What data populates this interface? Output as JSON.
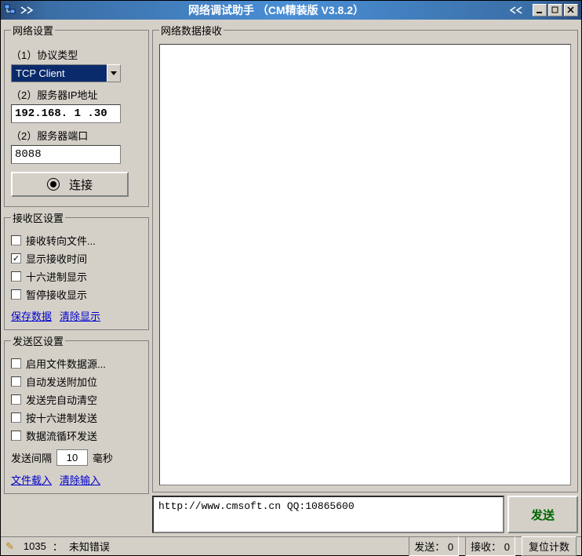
{
  "title": "网络调试助手 （CM精装版 V3.8.2）",
  "groups": {
    "network": {
      "legend": "网络设置",
      "protocol_label": "（1）协议类型",
      "protocol_value": "TCP Client",
      "ip_label": "（2）服务器IP地址",
      "ip_value": "192.168. 1 .30",
      "port_label": "（2）服务器端口",
      "port_value": "8088",
      "connect_btn": "连接"
    },
    "recv": {
      "legend": "接收区设置",
      "opts": [
        {
          "label": "接收转向文件...",
          "checked": false
        },
        {
          "label": "显示接收时间",
          "checked": true
        },
        {
          "label": "十六进制显示",
          "checked": false
        },
        {
          "label": "暂停接收显示",
          "checked": false
        }
      ],
      "link_save": "保存数据",
      "link_clear": "清除显示"
    },
    "send": {
      "legend": "发送区设置",
      "opts": [
        {
          "label": "启用文件数据源...",
          "checked": false
        },
        {
          "label": "自动发送附加位",
          "checked": false
        },
        {
          "label": "发送完自动清空",
          "checked": false
        },
        {
          "label": "按十六进制发送",
          "checked": false
        },
        {
          "label": "数据流循环发送",
          "checked": false
        }
      ],
      "interval_label": "发送间隔",
      "interval_value": "10",
      "interval_unit": "毫秒",
      "link_file": "文件载入",
      "link_clear": "清除输入"
    }
  },
  "right": {
    "recv_legend": "网络数据接收",
    "send_text": "http://www.cmsoft.cn QQ:10865600",
    "send_btn": "发送"
  },
  "status": {
    "code": "1035",
    "msg": "未知错误",
    "sent_label": "发送：",
    "sent_value": "0",
    "recv_label": "接收：",
    "recv_value": "0",
    "reset_btn": "复位计数"
  }
}
